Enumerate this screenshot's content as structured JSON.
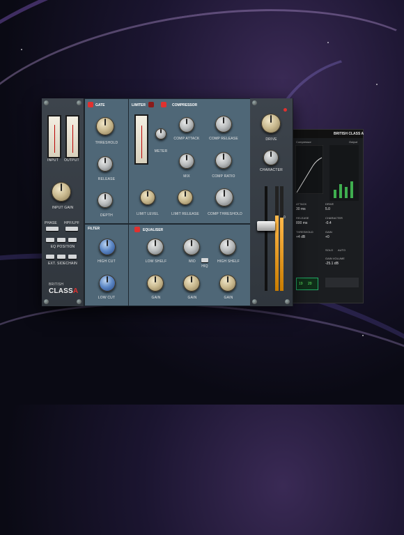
{
  "gate": {
    "title": "GATE",
    "threshold": "THRESHOLD",
    "release": "RELEASE",
    "depth": "DEPTH"
  },
  "limiter": {
    "title": "LIMITER",
    "meter": "METER",
    "limit_level": "LIMIT LEVEL",
    "limit_release": "LIMIT RELEASE"
  },
  "compressor": {
    "title": "COMPRESSOR",
    "attack": "COMP ATTACK",
    "release": "COMP RELEASE",
    "mix": "MIX",
    "ratio": "COMP RATIO",
    "threshold": "COMP THRESHOLD"
  },
  "filter": {
    "title": "FILTER",
    "high_cut": "HIGH CUT",
    "low_cut": "LOW CUT"
  },
  "equaliser": {
    "title": "EQUALISER",
    "low_shelf": "LOW SHELF",
    "mid": "MID",
    "high_shelf": "HIGH SHELF",
    "hiq": "HIQ",
    "gain": "GAIN"
  },
  "input": {
    "meter_left": "INPUT",
    "meter_right": "OUTPUT",
    "input_gain": "INPUT GAIN",
    "phase": "PHASE",
    "hpf_lpf": "HPF/LPF",
    "eq_position": "EQ POSITION",
    "ext_sidechain": "EXT. SIDECHAIN"
  },
  "brand": {
    "line1": "BRITISH",
    "line2": "CLASS",
    "accent": "A"
  },
  "drive": {
    "drive": "DRIVE",
    "character": "CHARACTER",
    "scale_top": "0",
    "scale_bottom": "0"
  },
  "window2": {
    "title": "BRITISH CLASS A",
    "tab": "Compressor",
    "output_label": "Output",
    "attack_label": "ATTACK",
    "attack_value": "30 ms",
    "release_label": "RELEASE",
    "release_value": "800 ms",
    "threshold_label": "THRESHOLD",
    "threshold_value": "+4 dB",
    "drive_label": "DRIVE",
    "drive_value": "5.0",
    "character_label": "CHARACTER",
    "character_value": "-0.4",
    "gain_label": "GAIN",
    "gain_value": "+0",
    "solo_label": "SOLO",
    "auto_label": "AUTO",
    "gain_volume_label": "GAIN VOLUME",
    "gain_volume_value": "-25.1 dB",
    "readout_a": "19",
    "readout_b": "20"
  },
  "colors": {
    "panel": "#4f6777",
    "red_led": "#e0312f",
    "knob_cream": "#d9c89a",
    "knob_blue": "#5b86c4"
  }
}
